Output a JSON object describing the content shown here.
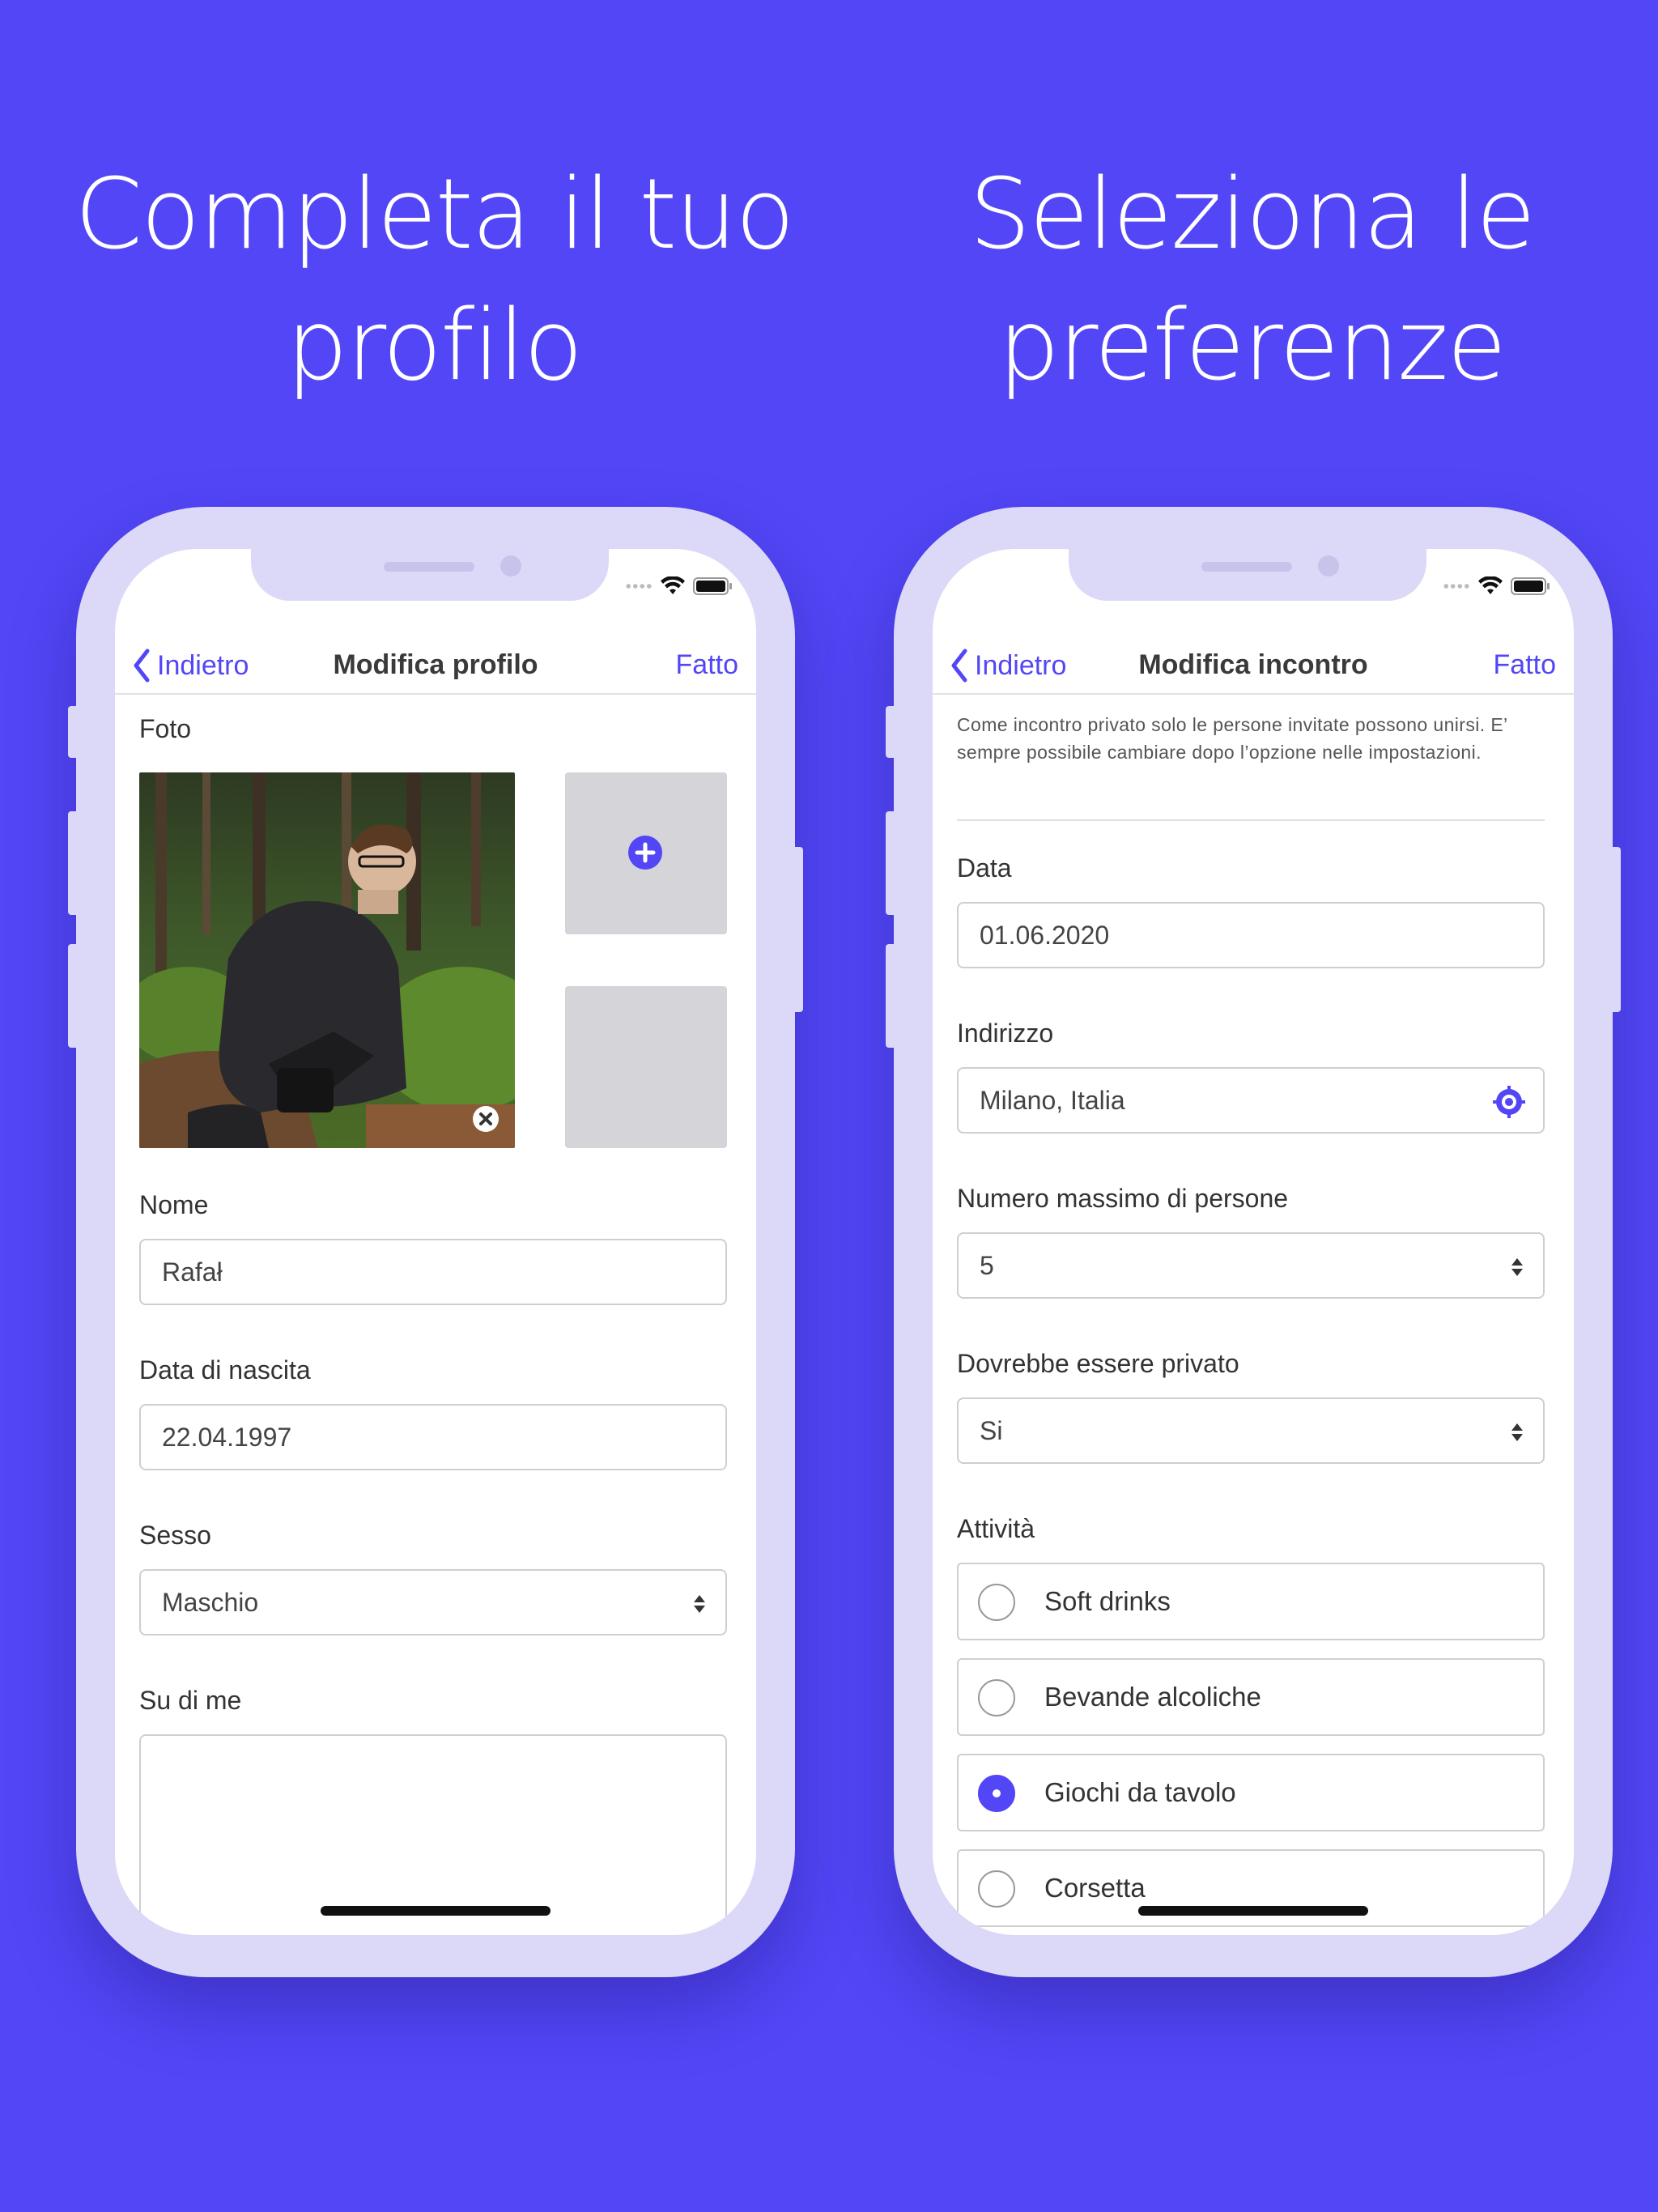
{
  "left_panel": {
    "headline_line1": "Completa il tuo",
    "headline_line2": "profilo",
    "nav": {
      "back_label": "Indietro",
      "title": "Modifica profilo",
      "done_label": "Fatto"
    },
    "form": {
      "photo_label": "Foto",
      "name_label": "Nome",
      "name_value": "Rafał",
      "birth_label": "Data di nascita",
      "birth_value": "22.04.1997",
      "gender_label": "Sesso",
      "gender_value": "Maschio",
      "about_label": "Su di me",
      "about_value": ""
    }
  },
  "right_panel": {
    "headline_line1": "Seleziona le",
    "headline_line2": "preferenze",
    "nav": {
      "back_label": "Indietro",
      "title": "Modifica incontro",
      "done_label": "Fatto"
    },
    "form": {
      "note": "Come incontro privato solo le persone invitate possono unirsi. E’ sempre possibile cambiare dopo l’opzione nelle impostazioni.",
      "date_label": "Data",
      "date_value": "01.06.2020",
      "address_label": "Indirizzo",
      "address_value": "Milano, Italia",
      "max_people_label": "Numero massimo di persone",
      "max_people_value": "5",
      "private_label": "Dovrebbe essere privato",
      "private_value": "Si",
      "activities_label": "Attività",
      "activities": [
        {
          "label": "Soft drinks",
          "selected": false
        },
        {
          "label": "Bevande alcoliche",
          "selected": false
        },
        {
          "label": "Giochi da tavolo",
          "selected": true
        },
        {
          "label": "Corsetta",
          "selected": false
        }
      ]
    }
  },
  "colors": {
    "background": "#5246F6",
    "accent": "#5246F6",
    "phone_frame": "#DCD9F8"
  },
  "icons": [
    "chevron-left-icon",
    "plus-icon",
    "remove-photo-icon",
    "updown-icon",
    "locate-icon",
    "wifi-icon",
    "battery-icon"
  ]
}
